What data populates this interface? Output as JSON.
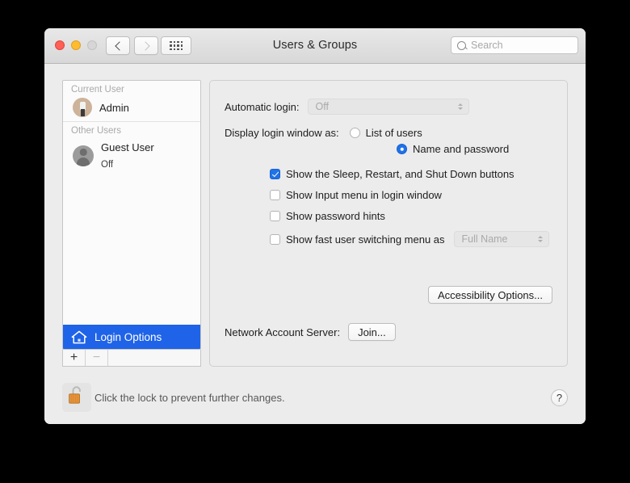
{
  "window": {
    "title": "Users & Groups",
    "traffic_lights": [
      {
        "name": "close",
        "color": "#ff5f57"
      },
      {
        "name": "minimize",
        "color": "#febc2e"
      },
      {
        "name": "zoom",
        "color": "#d6d6d6"
      }
    ],
    "nav": {
      "back_icon": "chevron-left-icon",
      "forward_icon": "chevron-right-icon",
      "grid_icon": "show-all-grid-icon"
    },
    "search": {
      "placeholder": "Search",
      "value": "",
      "icon": "search-icon"
    }
  },
  "sidebar": {
    "groups": [
      {
        "header": "Current User",
        "users": [
          {
            "name": "Admin",
            "status": "",
            "avatar": "user-photo-avatar"
          }
        ]
      },
      {
        "header": "Other Users",
        "users": [
          {
            "name": "Guest User",
            "status": "Off",
            "avatar": "generic-person-icon"
          }
        ]
      }
    ],
    "login_options": {
      "label": "Login Options",
      "icon": "house-icon",
      "selected": true,
      "highlight_color": "#1f63e8"
    },
    "add_button": "+",
    "remove_button": "−"
  },
  "main": {
    "automatic_login": {
      "label": "Automatic login:",
      "value": "Off",
      "enabled": false
    },
    "display_login_window": {
      "label": "Display login window as:",
      "options": [
        {
          "label": "List of users",
          "selected": false
        },
        {
          "label": "Name and password",
          "selected": true
        }
      ]
    },
    "checkboxes": [
      {
        "label": "Show the Sleep, Restart, and Shut Down buttons",
        "checked": true
      },
      {
        "label": "Show Input menu in login window",
        "checked": false
      },
      {
        "label": "Show password hints",
        "checked": false
      },
      {
        "label": "Show fast user switching menu as",
        "checked": false
      }
    ],
    "fast_user_switching_popup": {
      "value": "Full Name",
      "enabled": false
    },
    "accessibility_button": "Accessibility Options...",
    "network_account_server": {
      "label": "Network Account Server:",
      "button": "Join..."
    }
  },
  "footer": {
    "lock_icon": "unlocked-padlock-icon",
    "lock_text": "Click the lock to prevent further changes.",
    "help_button": "?"
  },
  "colors": {
    "accent": "#1f72e8",
    "selection": "#1f63e8",
    "window_bg": "#ececec",
    "lock_gold": "#e5923a"
  }
}
